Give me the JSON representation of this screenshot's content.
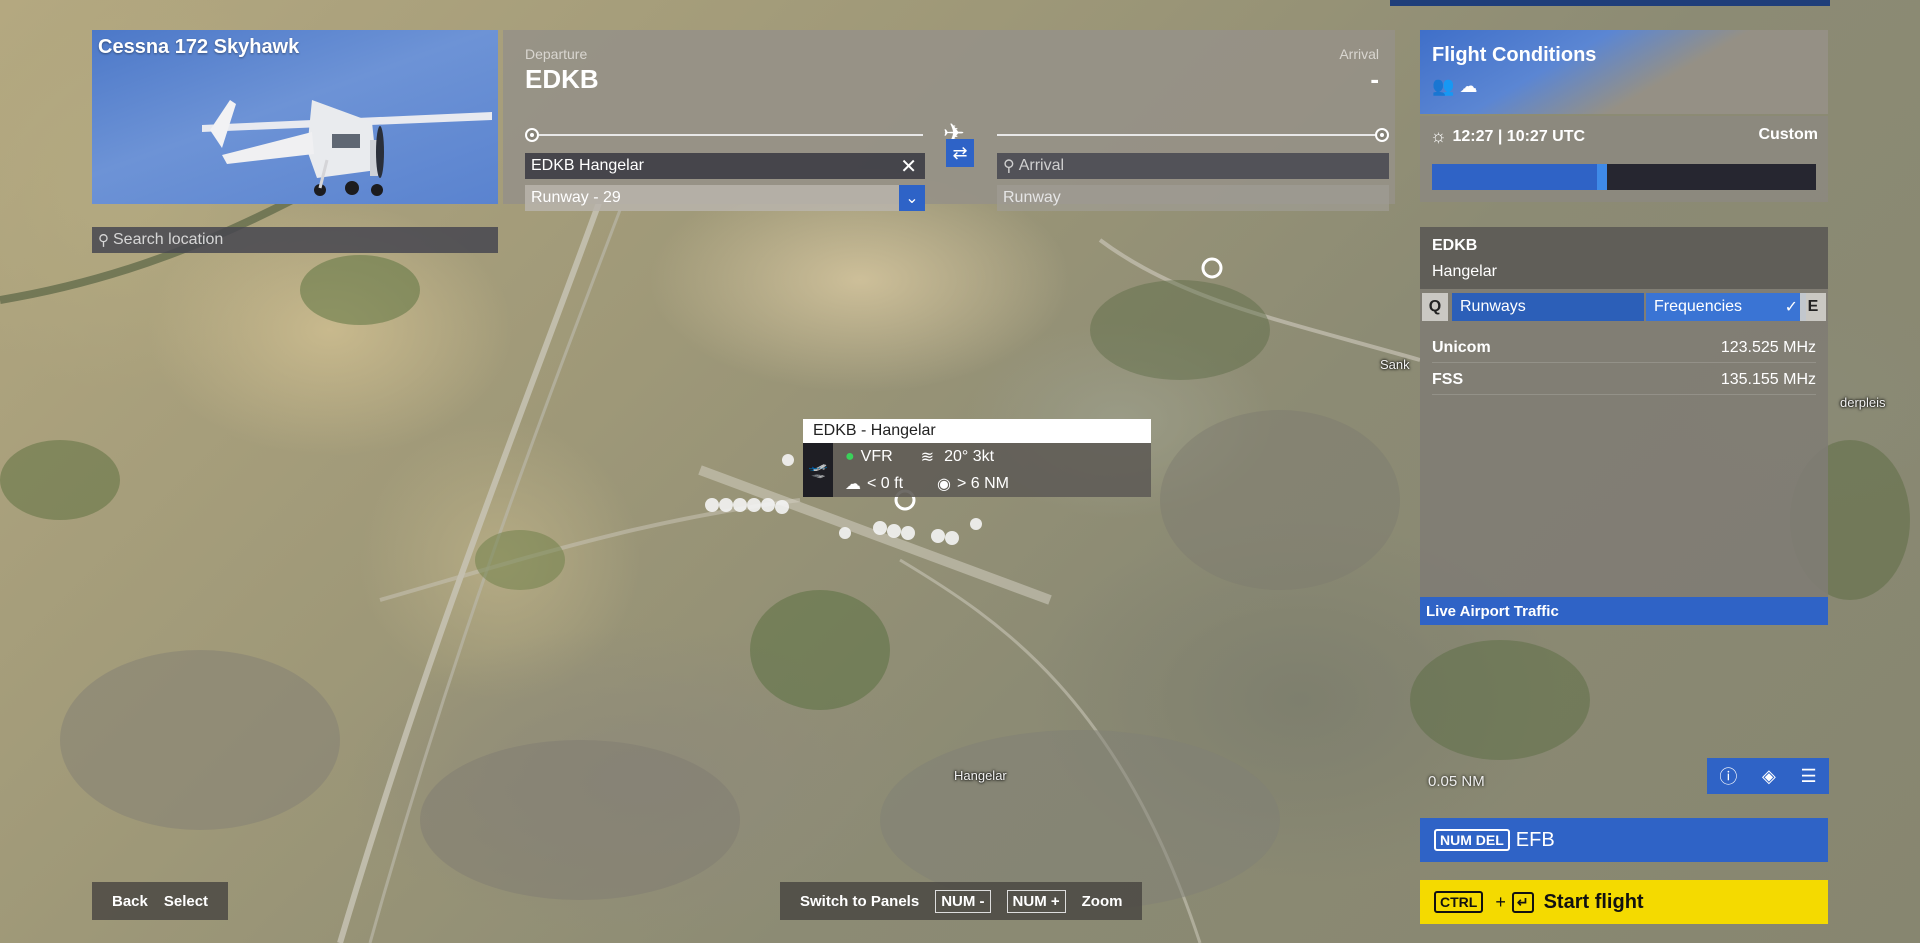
{
  "aircraft": {
    "name": "Cessna 172 Skyhawk"
  },
  "search": {
    "placeholder": "Search location"
  },
  "route": {
    "departure_label": "Departure",
    "departure_code": "EDKB",
    "arrival_label": "Arrival",
    "arrival_code": "-",
    "departure_airport": "EDKB Hangelar",
    "departure_runway": "Runway - 29",
    "arrival_placeholder": "Arrival",
    "arrival_runway": "Runway"
  },
  "conditions": {
    "title": "Flight Conditions",
    "time": "12:27 | 10:27 UTC",
    "mode": "Custom",
    "time_progress": 0.43
  },
  "airport": {
    "icao": "EDKB",
    "name": "Hangelar",
    "tabs": {
      "q": "Q",
      "runways": "Runways",
      "frequencies": "Frequencies",
      "e": "E"
    },
    "frequencies": [
      {
        "name": "Unicom",
        "value": "123.525 MHz"
      },
      {
        "name": "FSS",
        "value": "135.155 MHz"
      }
    ],
    "live_traffic": "Live Airport Traffic"
  },
  "popup": {
    "title": "EDKB - Hangelar",
    "rules": "VFR",
    "wind": "20° 3kt",
    "ceiling": "< 0 ft",
    "visibility": "> 6 NM"
  },
  "map": {
    "place_hangelar": "Hangelar",
    "place_sank": "Sank",
    "place_derpleis": "derpleis",
    "scale": "0.05 NM"
  },
  "controls": {
    "efb_key": "NUM DEL",
    "efb_label": "EFB",
    "start_key": "CTRL",
    "start_plus": "+",
    "start_label": "Start flight",
    "back": "Back",
    "select": "Select",
    "switch_panels": "Switch to Panels",
    "num_minus": "NUM -",
    "num_plus": "NUM +",
    "zoom": "Zoom"
  },
  "colors": {
    "accent_blue": "#2f63c6",
    "start_yellow": "#f4da00",
    "vfr_green": "#3ad15a"
  }
}
